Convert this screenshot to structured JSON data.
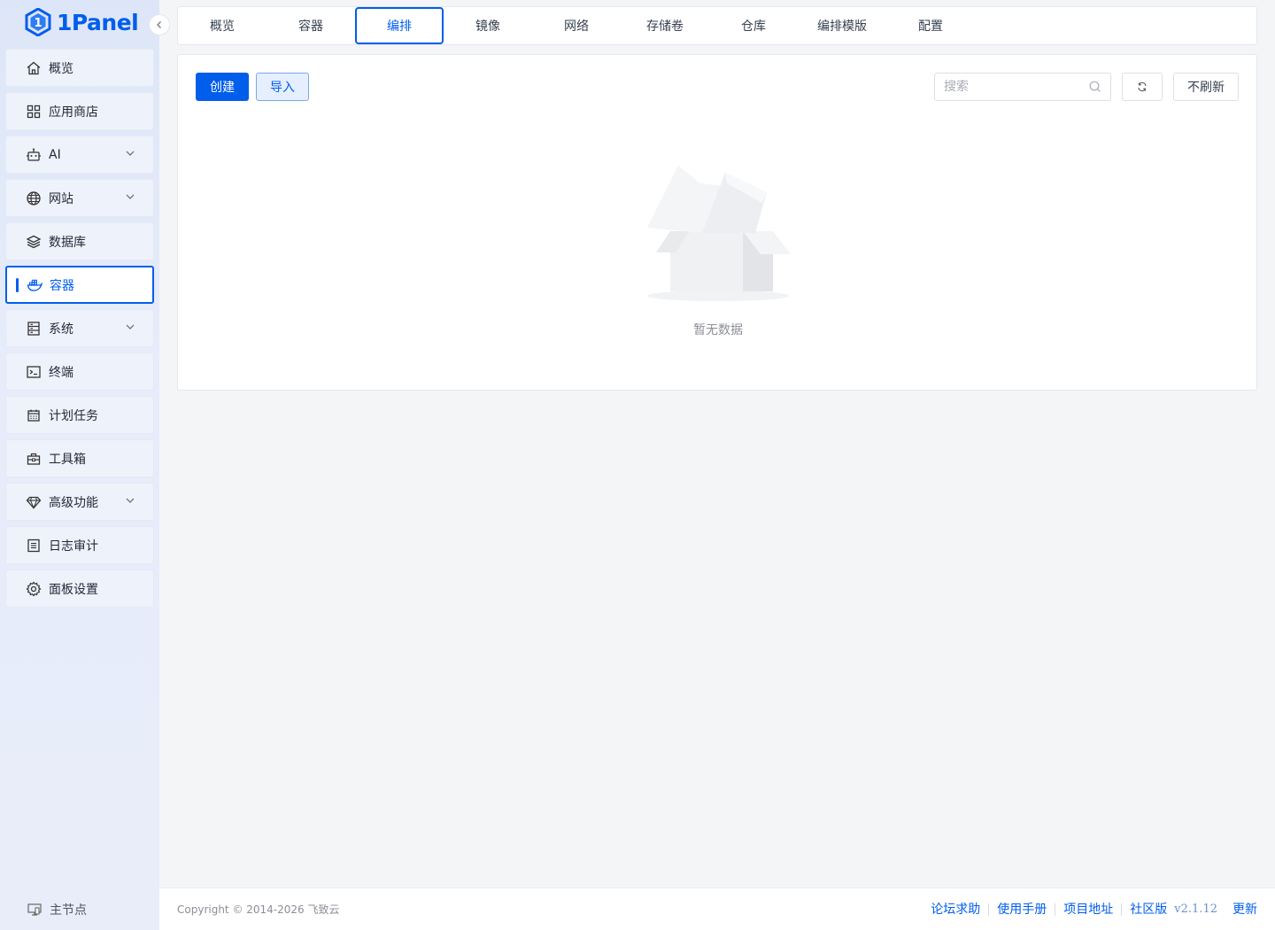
{
  "brand": {
    "name": "1Panel",
    "color": "#005eeb"
  },
  "sidebar": {
    "collapse_icon": "chevron-left-icon",
    "items": [
      {
        "label": "概览",
        "icon": "home-icon",
        "expandable": false
      },
      {
        "label": "应用商店",
        "icon": "grid-icon",
        "expandable": false
      },
      {
        "label": "AI",
        "icon": "robot-icon",
        "expandable": true
      },
      {
        "label": "网站",
        "icon": "globe-icon",
        "expandable": true
      },
      {
        "label": "数据库",
        "icon": "layers-icon",
        "expandable": false
      },
      {
        "label": "容器",
        "icon": "docker-icon",
        "expandable": false,
        "active": true
      },
      {
        "label": "系统",
        "icon": "server-icon",
        "expandable": true
      },
      {
        "label": "终端",
        "icon": "terminal-icon",
        "expandable": false
      },
      {
        "label": "计划任务",
        "icon": "calendar-icon",
        "expandable": false
      },
      {
        "label": "工具箱",
        "icon": "toolbox-icon",
        "expandable": false
      },
      {
        "label": "高级功能",
        "icon": "diamond-icon",
        "expandable": true
      },
      {
        "label": "日志审计",
        "icon": "log-icon",
        "expandable": false
      },
      {
        "label": "面板设置",
        "icon": "gear-icon",
        "expandable": false
      }
    ],
    "node_label": "主节点"
  },
  "tabs": [
    {
      "label": "概览"
    },
    {
      "label": "容器"
    },
    {
      "label": "编排",
      "active": true
    },
    {
      "label": "镜像"
    },
    {
      "label": "网络"
    },
    {
      "label": "存储卷"
    },
    {
      "label": "仓库"
    },
    {
      "label": "编排模版"
    },
    {
      "label": "配置"
    }
  ],
  "toolbar": {
    "create_label": "创建",
    "import_label": "导入",
    "search_placeholder": "搜索",
    "no_refresh_label": "不刷新"
  },
  "empty": {
    "text": "暂无数据"
  },
  "footer": {
    "copyright": "Copyright © 2014-2026 飞致云",
    "links": [
      "论坛求助",
      "使用手册",
      "项目地址",
      "社区版"
    ],
    "version": "v2.1.12",
    "update_label": "更新"
  }
}
